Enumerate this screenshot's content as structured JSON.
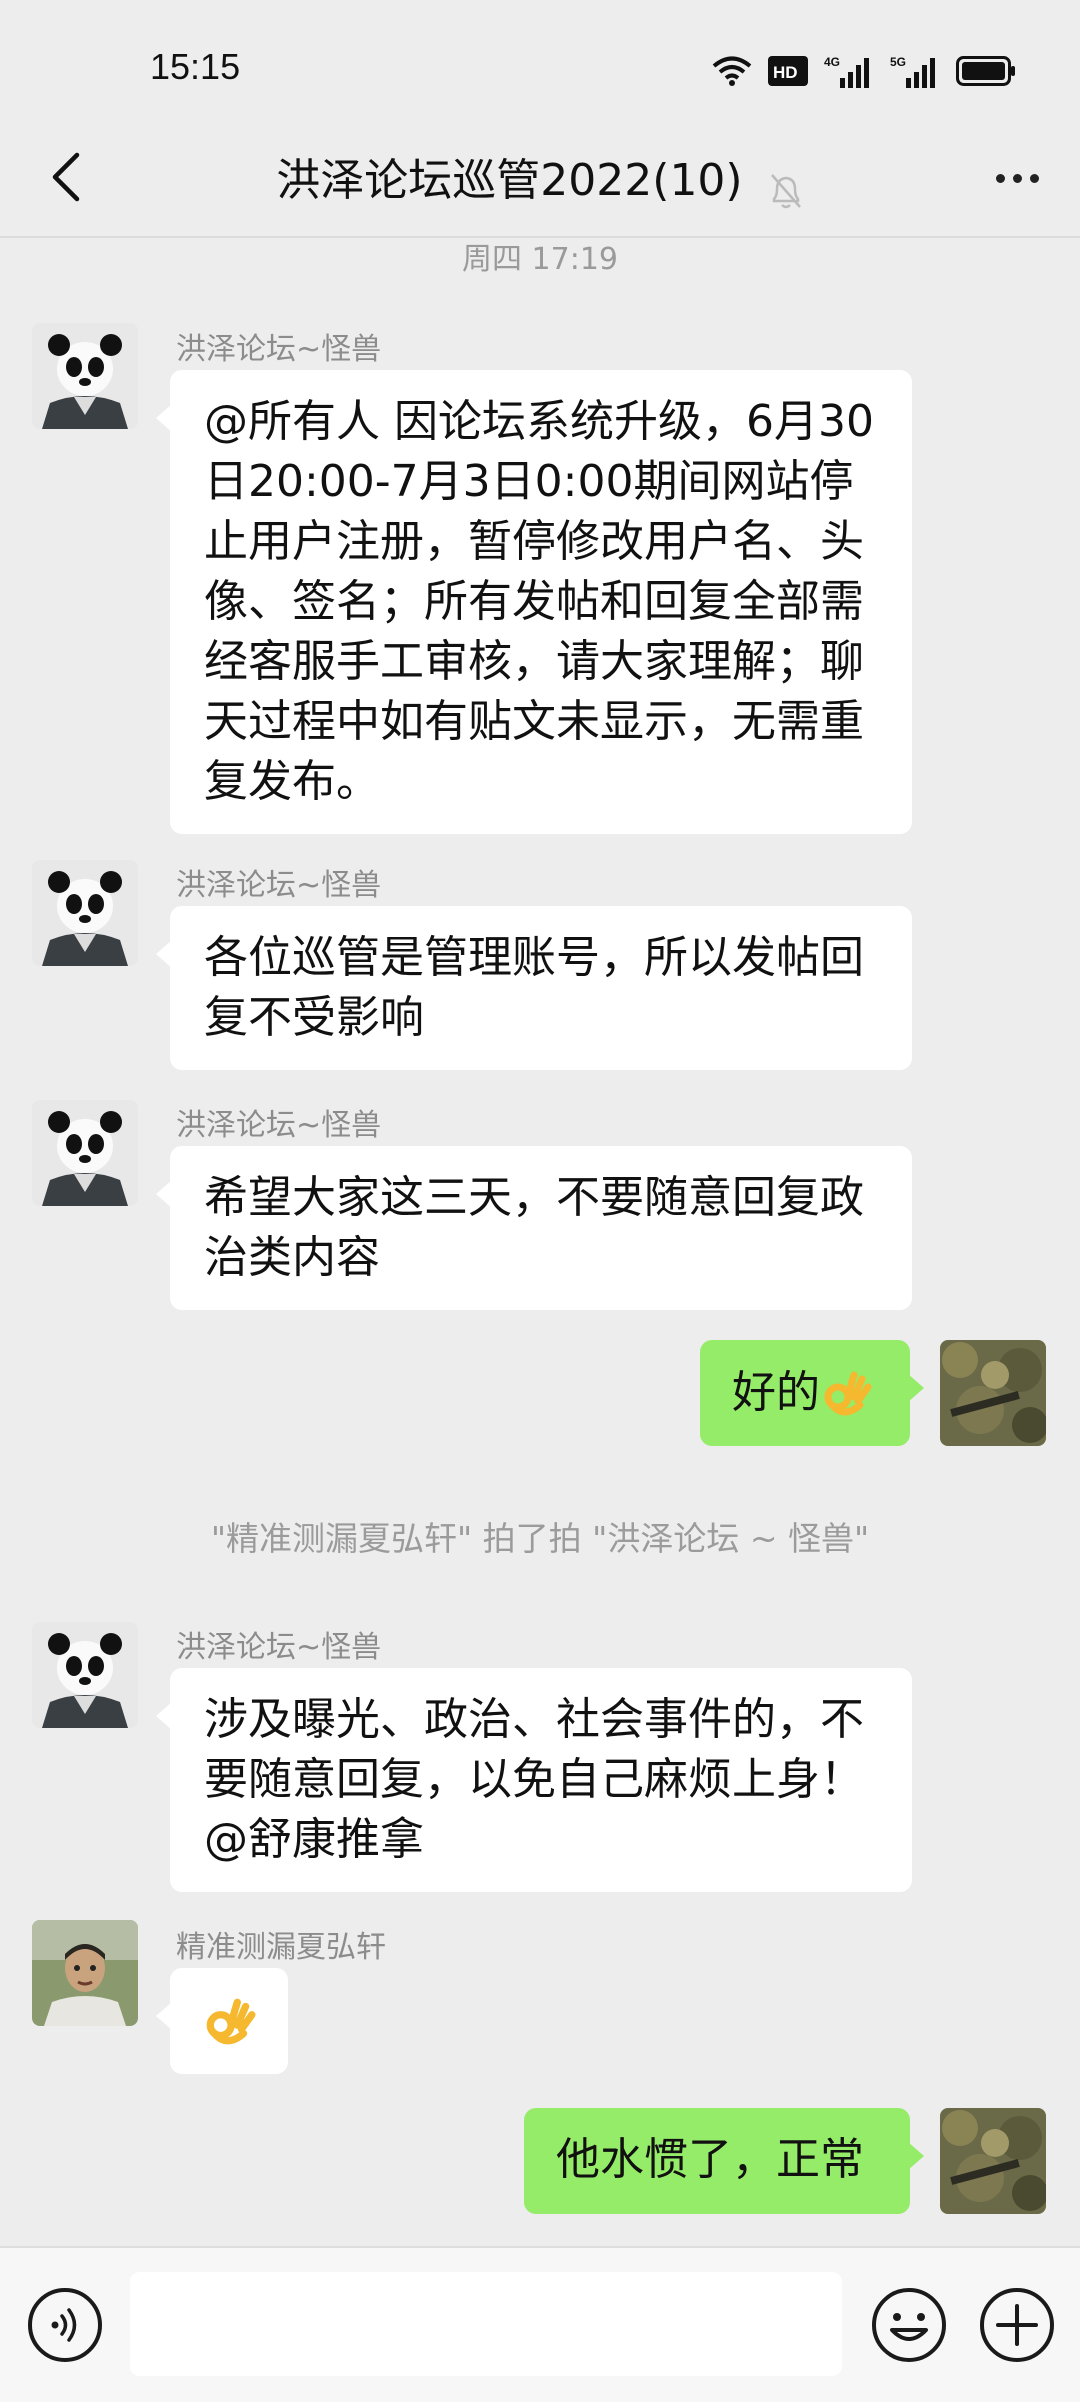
{
  "status": {
    "time": "15:15",
    "hd_badge": "HD",
    "sim1_label": "4G",
    "sim2_label": "5G"
  },
  "header": {
    "title": "洪泽论坛巡管2022(10)",
    "back_icon": "chevron-left-icon",
    "mute_icon": "bell-off-icon",
    "more_icon": "more-dots-icon"
  },
  "messages": {
    "timestamp": "周四 17:19",
    "m1": {
      "sender": "洪泽论坛~怪兽",
      "text": "@所有人  因论坛系统升级，6月30日20:00-7月3日0:00期间网站停止用户注册，暂停修改用户名、头像、签名；所有发帖和回复全部需经客服手工审核，请大家理解；聊天过程中如有贴文未显示，无需重复发布。"
    },
    "m2": {
      "sender": "洪泽论坛~怪兽",
      "text": "各位巡管是管理账号，所以发帖回复不受影响"
    },
    "m3": {
      "sender": "洪泽论坛~怪兽",
      "text": "希望大家这三天，不要随意回复政治类内容"
    },
    "m4": {
      "text": "好的",
      "emoji": "ok-hand-emoji"
    },
    "system": "\"精准测漏夏弘轩\" 拍了拍 \"洪泽论坛 ~ 怪兽\"",
    "m5": {
      "sender": "洪泽论坛~怪兽",
      "text": "涉及曝光、政治、社会事件的，不要随意回复，以免自己麻烦上身！@舒康推拿"
    },
    "m6": {
      "sender": "精准测漏夏弘轩",
      "emoji": "ok-hand-emoji"
    },
    "m7": {
      "text": "他水惯了，正常"
    }
  },
  "input_bar": {
    "voice_icon": "voice-icon",
    "input_value": "",
    "emoji_icon": "smiley-icon",
    "plus_icon": "plus-icon"
  },
  "colors": {
    "background": "#ededed",
    "my_bubble": "#95ec69",
    "their_bubble": "#ffffff",
    "meta_text": "#9a9a9a"
  }
}
